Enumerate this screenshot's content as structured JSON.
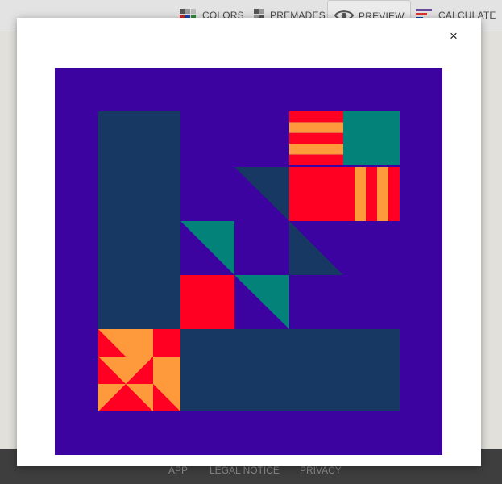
{
  "nav": {
    "colors_label": "COLORS",
    "premades_label": "PREMADES",
    "preview_label": "PREVIEW",
    "calculate_label": "CALCULATE"
  },
  "footer": {
    "app_link": "APP",
    "legal_link": "LEGAL NOTICE",
    "privacy_link": "PRIVACY"
  },
  "modal": {
    "close_label": "×"
  },
  "quilt_colors": {
    "background": "#3c03a1",
    "navy": "#163862",
    "teal": "#028278",
    "red": "#ff0022",
    "orange": "#ff9a3c"
  }
}
